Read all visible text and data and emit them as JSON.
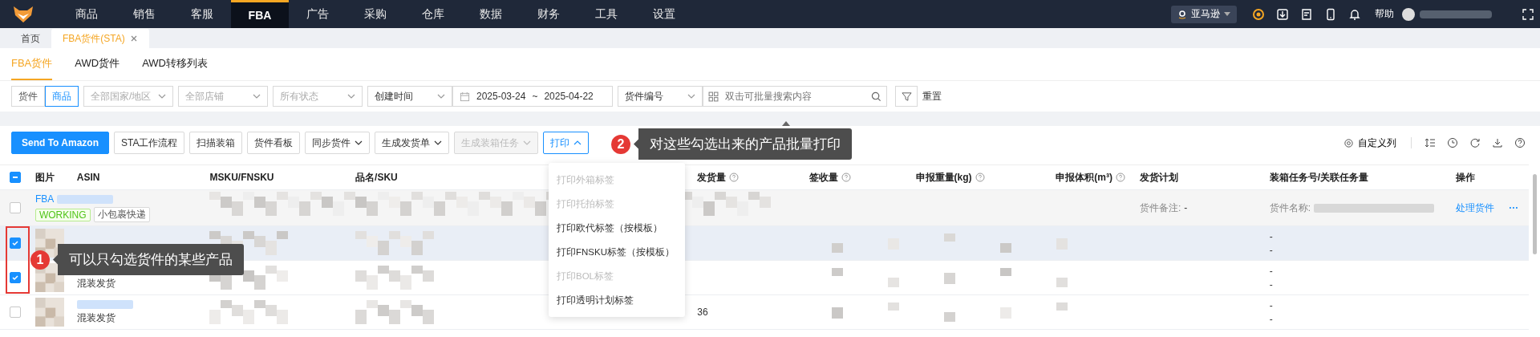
{
  "nav": {
    "items": [
      {
        "label": "商品",
        "selected": false
      },
      {
        "label": "销售",
        "selected": false
      },
      {
        "label": "客服",
        "selected": false
      },
      {
        "label": "FBA",
        "selected": true
      },
      {
        "label": "广告",
        "selected": false
      },
      {
        "label": "采购",
        "selected": false
      },
      {
        "label": "仓库",
        "selected": false
      },
      {
        "label": "数据",
        "selected": false
      },
      {
        "label": "财务",
        "selected": false
      },
      {
        "label": "工具",
        "selected": false
      },
      {
        "label": "设置",
        "selected": false
      }
    ],
    "platform": "亚马逊",
    "help": "帮助"
  },
  "page_tabs": [
    {
      "label": "首页",
      "selected": false,
      "closable": false
    },
    {
      "label": "FBA货件(STA)",
      "selected": true,
      "closable": true
    }
  ],
  "sub_tabs": [
    {
      "label": "FBA货件",
      "selected": true
    },
    {
      "label": "AWD货件",
      "selected": false
    },
    {
      "label": "AWD转移列表",
      "selected": false
    }
  ],
  "filters": {
    "mode": [
      {
        "label": "货件",
        "selected": false
      },
      {
        "label": "商品",
        "selected": true
      }
    ],
    "selects": [
      {
        "placeholder": "全部国家/地区"
      },
      {
        "placeholder": "全部店铺"
      },
      {
        "placeholder": "所有状态"
      },
      {
        "value": "创建时间"
      }
    ],
    "date_start": "2025-03-24",
    "date_sep": "~",
    "date_end": "2025-04-22",
    "search_field": "货件编号",
    "search_placeholder": "双击可批量搜索内容",
    "reset": "重置"
  },
  "toolbar": {
    "buttons": [
      {
        "label": "Send To Amazon",
        "kind": "primary",
        "caret": false,
        "disabled": false
      },
      {
        "label": "STA工作流程",
        "kind": "plain",
        "caret": false,
        "disabled": false
      },
      {
        "label": "扫描装箱",
        "kind": "plain",
        "caret": false,
        "disabled": false
      },
      {
        "label": "货件看板",
        "kind": "plain",
        "caret": false,
        "disabled": false
      },
      {
        "label": "同步货件",
        "kind": "plain",
        "caret": true,
        "disabled": false
      },
      {
        "label": "生成发货单",
        "kind": "plain",
        "caret": true,
        "disabled": false
      },
      {
        "label": "生成装箱任务",
        "kind": "plain",
        "caret": true,
        "disabled": true
      },
      {
        "label": "打印",
        "kind": "open",
        "caret": true,
        "disabled": false
      }
    ],
    "custom_columns": "自定义列"
  },
  "print_menu": [
    {
      "label": "打印外箱标签",
      "disabled": true
    },
    {
      "label": "打印托拍标签",
      "disabled": true
    },
    {
      "label": "打印欧代标签（按模板）",
      "disabled": false
    },
    {
      "label": "打印FNSKU标签（按模板）",
      "disabled": false
    },
    {
      "label": "打印BOL标签",
      "disabled": true
    },
    {
      "label": "打印透明计划标签",
      "disabled": false
    }
  ],
  "table": {
    "header_indeterminate": true,
    "columns": [
      {
        "label": "图片",
        "help": false
      },
      {
        "label": "ASIN",
        "help": false
      },
      {
        "label": "MSKU/FNSKU",
        "help": false
      },
      {
        "label": "品名/SKU",
        "help": false
      },
      {
        "label": "发货量",
        "help": true
      },
      {
        "label": "签收量",
        "help": true
      },
      {
        "label": "申报重量(kg)",
        "help": true
      },
      {
        "label": "申报体积(m³)",
        "help": true
      },
      {
        "label": "发货计划",
        "help": false
      },
      {
        "label": "装箱任务号/关联任务量",
        "help": false
      },
      {
        "label": "操作",
        "help": false
      }
    ],
    "rows": [
      {
        "kind": "shipment",
        "checked": false,
        "id_prefix": "FBA",
        "status": "WORKING",
        "tag": "小包裹快递",
        "note_label": "货件备注:",
        "note": "-",
        "name_label": "货件名称:",
        "action": "处理货件",
        "more": "···"
      },
      {
        "kind": "product",
        "checked": true,
        "highlighted": true,
        "task_lines": [
          "-",
          "-"
        ]
      },
      {
        "kind": "product",
        "checked": true,
        "highlighted": false,
        "ship_type": "混装发货",
        "task_lines": [
          "-",
          "-"
        ]
      },
      {
        "kind": "product",
        "checked": false,
        "highlighted": false,
        "ship_type": "混装发货",
        "shipped": "36",
        "task_lines": [
          "-",
          "-"
        ]
      }
    ]
  },
  "callouts": [
    {
      "number": "2",
      "text": "对这些勾选出来的产品批量打印"
    },
    {
      "number": "1",
      "text": "可以只勾选货件的某些产品"
    }
  ]
}
